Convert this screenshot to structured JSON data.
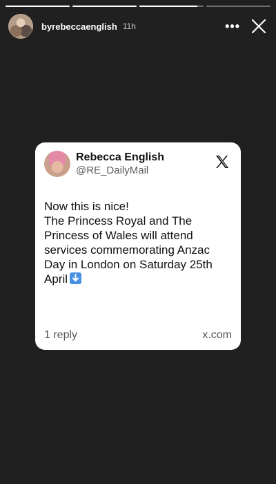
{
  "story": {
    "progress": [
      1,
      1,
      0.9,
      0
    ],
    "username": "byrebeccaenglish",
    "timestamp": "11h"
  },
  "tweet": {
    "author_name": "Rebecca English",
    "handle": "@RE_DailyMail",
    "text": "Now this is nice!\nThe Princess Royal and The Princess of Wales will attend services commemorating Anzac Day in London on Saturday 25th April",
    "emoji": "down-arrow-emoji",
    "replies": "1 reply",
    "source": "x.com"
  },
  "icons": {
    "close": "close-icon",
    "more": "more-icon",
    "x_logo": "x-logo-icon"
  }
}
